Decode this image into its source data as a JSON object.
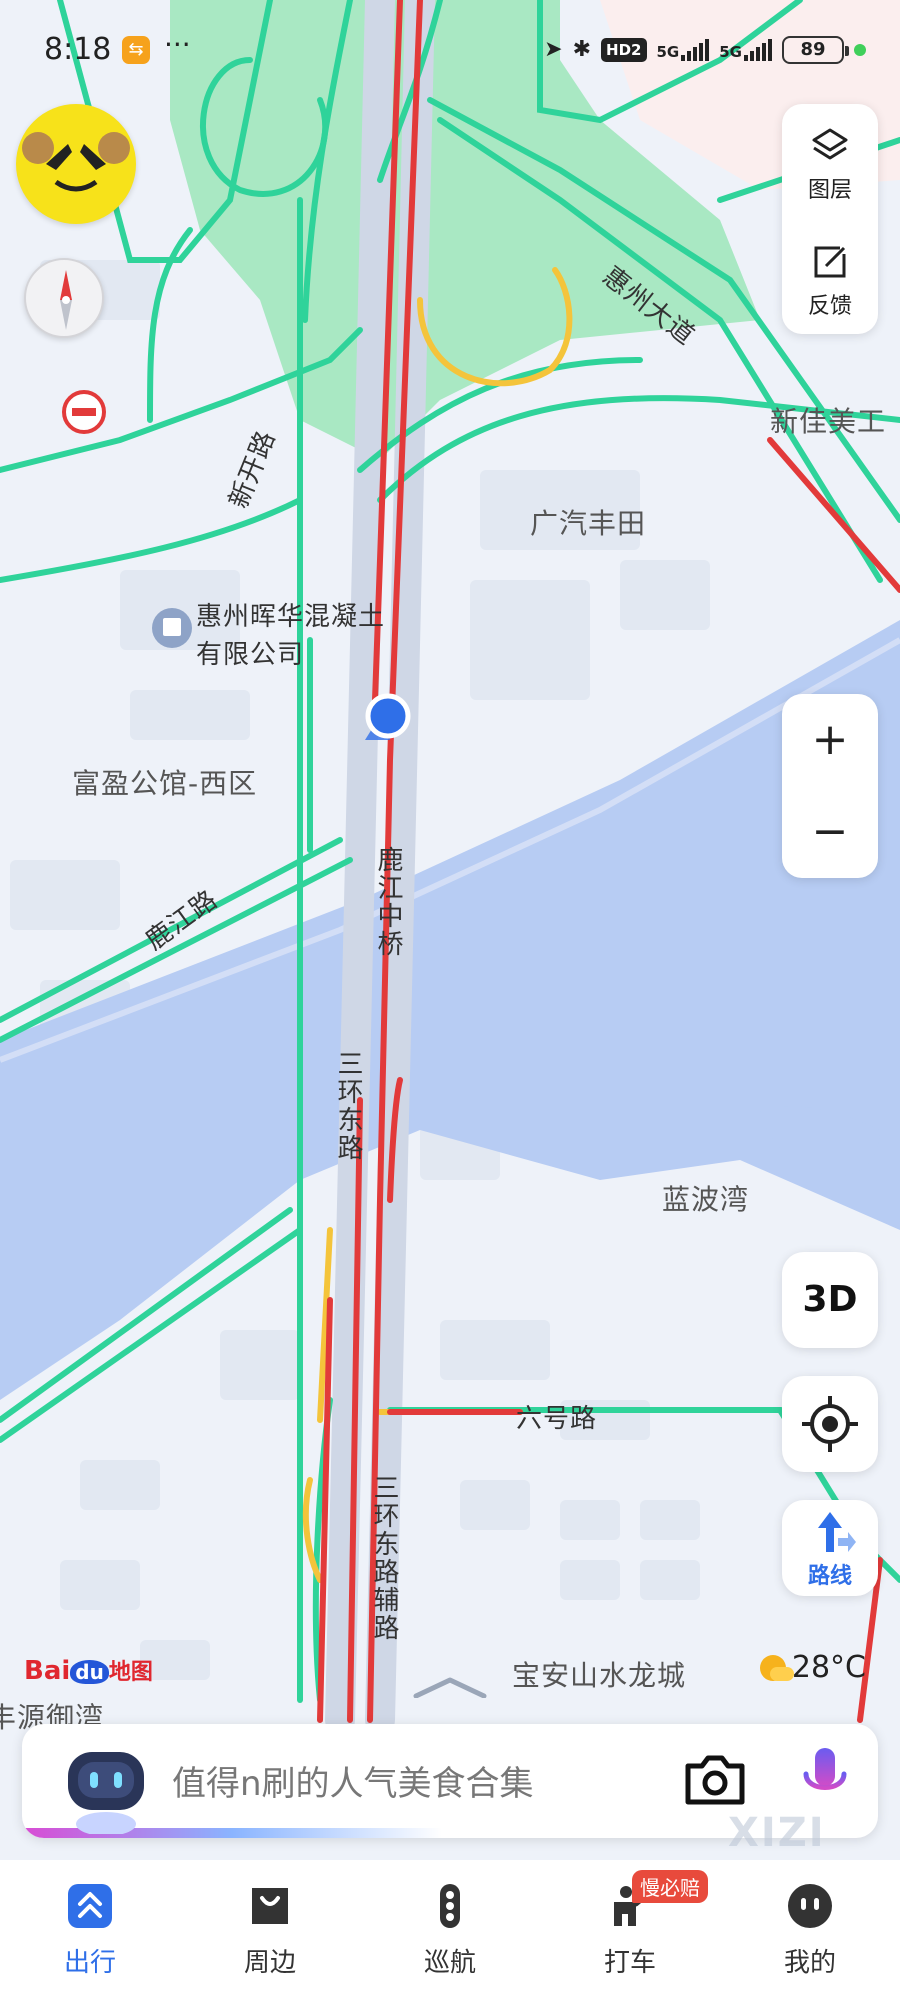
{
  "status_bar": {
    "time": "8:18",
    "more": "···",
    "hd": "HD2",
    "net1": "5G",
    "net2": "5G",
    "battery": "89"
  },
  "side_panel": {
    "layers_label": "图层",
    "feedback_label": "反馈"
  },
  "zoom": {
    "in": "+",
    "out": "−"
  },
  "controls": {
    "threed_label": "3D",
    "route_label": "路线"
  },
  "map_labels": {
    "huizhou_avenue": "惠州大道",
    "xinjia": "新佳美工",
    "gac_toyota": "广汽丰田",
    "poi_company_line1": "惠州晖华混凝土",
    "poi_company_line2": "有限公司",
    "fuying": "富盈公馆-西区",
    "lujiang_road": "鹿江路",
    "lujiang_bridge": "鹿江中桥",
    "sanhuan_east": "三环东路",
    "sanhuan_aux": "三环东路辅路",
    "xinkai_road": "新开路",
    "lanbo_bay": "蓝波湾",
    "liuhao_road": "六号路",
    "baoan_city": "宝安山水龙城",
    "yuan_yuwan": "丰源御湾"
  },
  "brand": {
    "logo_bai": "Bai",
    "logo_du": "du",
    "logo_map": "地图"
  },
  "weather": {
    "temp": "28°C"
  },
  "search": {
    "placeholder": "值得n刷的人气美食合集"
  },
  "watermark": "XIZI",
  "bottom_nav": [
    {
      "label": "出行",
      "active": true
    },
    {
      "label": "周边",
      "active": false
    },
    {
      "label": "巡航",
      "active": false
    },
    {
      "label": "打车",
      "active": false,
      "badge": "慢必赔"
    },
    {
      "label": "我的",
      "active": false
    }
  ],
  "colors": {
    "accent": "#2f6fe8",
    "road_green": "#2fd39a",
    "road_red": "#e23a3a",
    "road_yellow": "#f4c43b",
    "water": "#b9cdf4",
    "park": "#a6e8bf"
  }
}
